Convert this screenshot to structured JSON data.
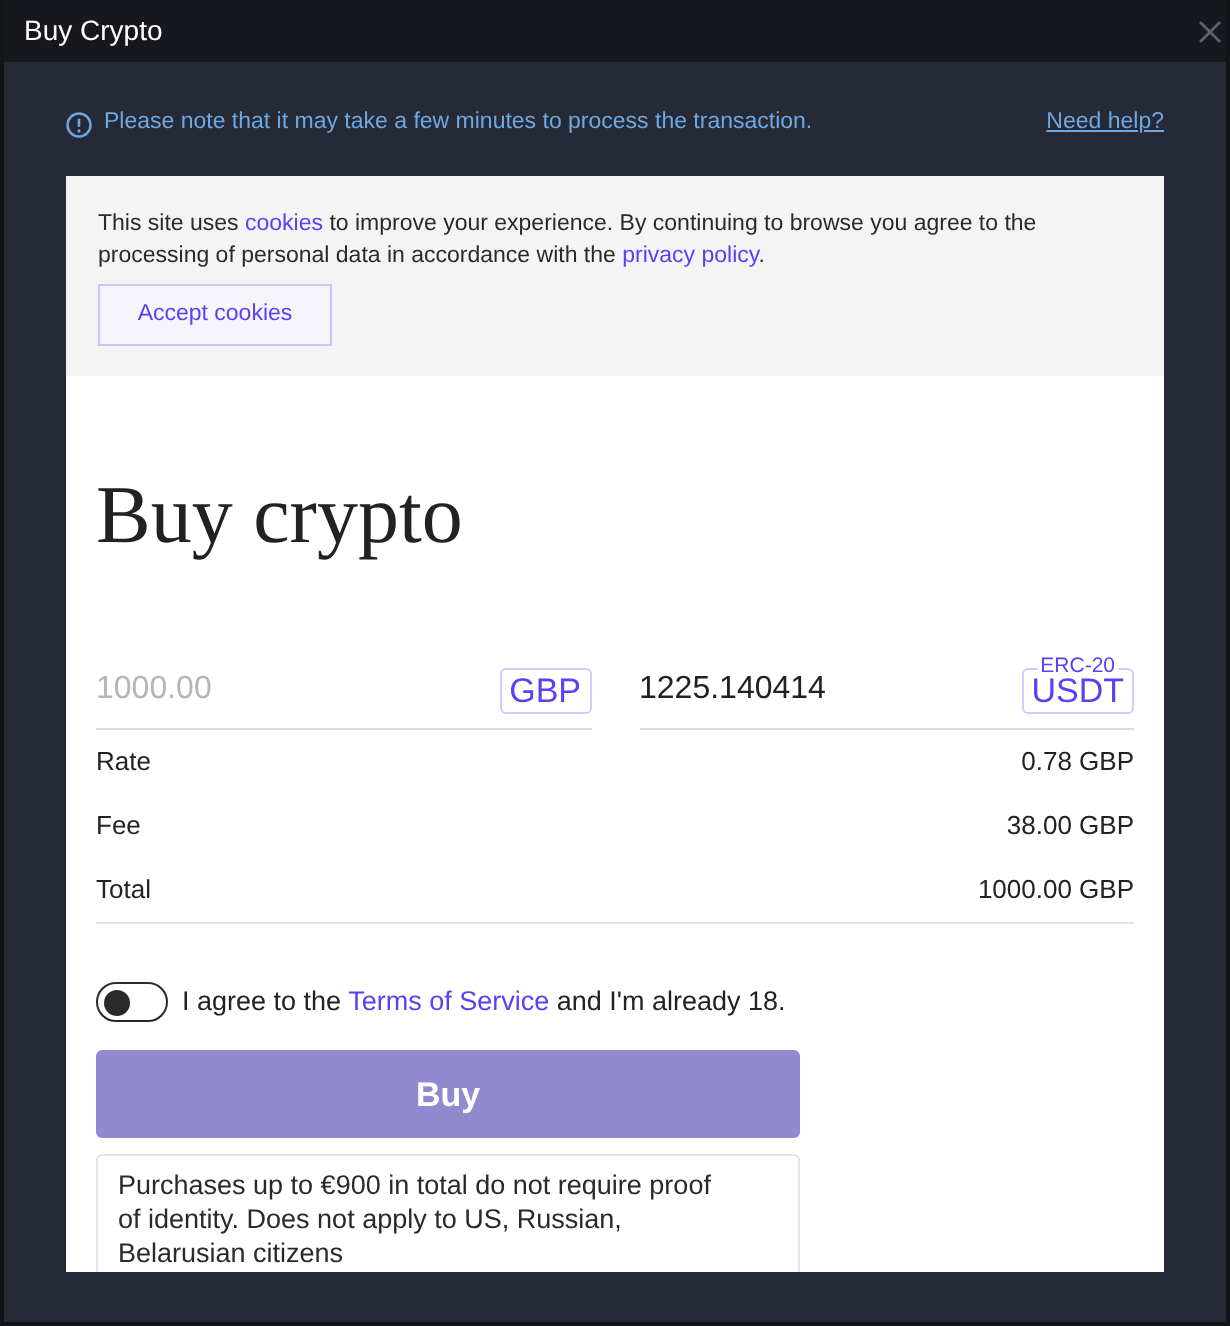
{
  "window": {
    "title": "Buy Crypto"
  },
  "notice": {
    "text": "Please note that it may take a few minutes to process the transaction.",
    "help_link": "Need help?"
  },
  "cookie_banner": {
    "segments": [
      {
        "kind": "text",
        "text": "This site uses "
      },
      {
        "kind": "link",
        "text": "cookies"
      },
      {
        "kind": "text",
        "text": " to improve your experience. By continuing to browse you agree to the processing of personal data in accordance with the "
      },
      {
        "kind": "link",
        "text": "privacy policy"
      },
      {
        "kind": "text",
        "text": "."
      }
    ],
    "button": "Accept cookies"
  },
  "heading": "Buy crypto",
  "amount_from": {
    "placeholder": "1000.00",
    "currency": "GBP"
  },
  "amount_to": {
    "value": "1225.140414",
    "currency": "USDT",
    "network": "ERC-20"
  },
  "summary": [
    {
      "label": "Rate",
      "value": "0.78 GBP"
    },
    {
      "label": "Fee",
      "value": "38.00 GBP"
    },
    {
      "label": "Total",
      "value": "1000.00 GBP"
    }
  ],
  "agreement": {
    "on": false,
    "segments": [
      {
        "kind": "text",
        "text": "I agree to the "
      },
      {
        "kind": "link",
        "text": "Terms of Service"
      },
      {
        "kind": "text",
        "text": " and I'm already 18."
      }
    ]
  },
  "buy_button": {
    "label": "Buy",
    "disabled": true
  },
  "info": "Purchases up to €900 in total do not require proof of identity. Does not apply to US, Russian, Belarusian citizens"
}
